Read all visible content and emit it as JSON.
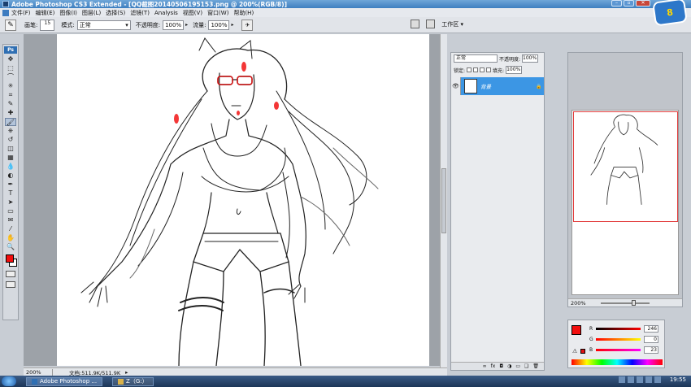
{
  "window": {
    "title": "Adobe Photoshop CS3 Extended - [QQ截图20140506195153.png @ 200%(RGB/8)]"
  },
  "menu": {
    "items": [
      "文件(F)",
      "编辑(E)",
      "图像(I)",
      "图层(L)",
      "选择(S)",
      "滤镜(T)",
      "Analysis",
      "视图(V)",
      "窗口(W)",
      "帮助(H)"
    ]
  },
  "options": {
    "brush_label": "画笔:",
    "brush_size": "15",
    "mode_label": "模式:",
    "mode_value": "正常",
    "opacity_label": "不透明度:",
    "opacity_value": "100%",
    "flow_label": "流量:",
    "flow_value": "100%",
    "workspace_label": "工作区 ▾"
  },
  "toolbox": {
    "ps_label": "Ps",
    "tools": [
      "move-tool",
      "marquee-tool",
      "lasso-tool",
      "magic-wand-tool",
      "crop-tool",
      "eyedropper-tool",
      "healing-tool",
      "brush-tool",
      "clone-stamp-tool",
      "history-brush-tool",
      "eraser-tool",
      "gradient-tool",
      "blur-tool",
      "dodge-tool",
      "pen-tool",
      "type-tool",
      "path-selection-tool",
      "shape-tool",
      "notes-tool",
      "eyedropper-2-tool",
      "hand-tool",
      "zoom-tool"
    ],
    "tool_glyphs": [
      "✥",
      "⬚",
      "⌒",
      "✳",
      "⌗",
      "✎",
      "✚",
      "🖌",
      "⎈",
      "↺",
      "◫",
      "▦",
      "💧",
      "◐",
      "✒",
      "T",
      "➤",
      "▭",
      "✉",
      "⁄",
      "✋",
      "🔍"
    ],
    "active_tool": 7,
    "fg_color": "#f20e0e",
    "bg_color": "#ffffff"
  },
  "document": {
    "zoom": "200%",
    "doc_info": "文档:511.9K/511.9K",
    "status_arrow": "▸"
  },
  "layers": {
    "blend_mode": "正常",
    "opacity_label": "不透明度:",
    "opacity_value": "100%",
    "lock_label": "锁定:",
    "fill_label": "填充:",
    "fill_value": "100%",
    "layer_name": "背景",
    "footer_icons": [
      "link-icon",
      "fx-icon",
      "mask-icon",
      "adjustment-icon",
      "group-icon",
      "new-layer-icon",
      "trash-icon"
    ],
    "footer_glyphs": [
      "∞",
      "fx",
      "◘",
      "◑",
      "▭",
      "❑",
      "🗑"
    ]
  },
  "navigator": {
    "zoom": "200%"
  },
  "color": {
    "r_label": "R",
    "g_label": "G",
    "b_label": "B",
    "r_value": "246",
    "g_value": "0",
    "b_value": "23",
    "warning_glyph": "⚠"
  },
  "taskbar": {
    "tasks": [
      "Adobe Photoshop ...",
      "Z（G:）"
    ],
    "clock": "19:55"
  },
  "logo_text": "8"
}
